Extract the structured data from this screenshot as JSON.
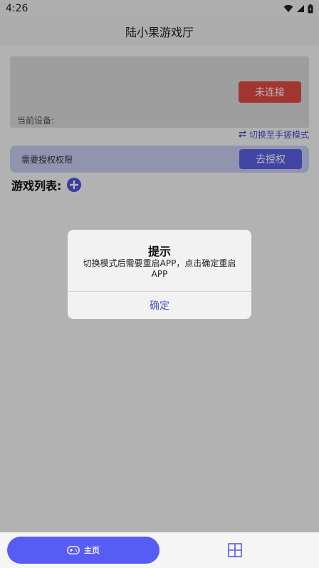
{
  "status_bar": {
    "time": "4:26"
  },
  "app_bar": {
    "title": "陆小果游戏厅"
  },
  "device_card": {
    "device_label": "当前设备:",
    "connect_label": "未连接"
  },
  "switch_mode": {
    "label": "切换至手搓模式"
  },
  "auth_bar": {
    "text": "需要授权权限",
    "button_label": "去授权"
  },
  "game_list": {
    "header": "游戏列表:"
  },
  "bottom_nav": {
    "home_label": "主页"
  },
  "dialog": {
    "title": "提示",
    "message": "切换模式后需要重启APP，点击确定重启APP",
    "confirm_label": "确定"
  },
  "colors": {
    "accent": "#5b60e3",
    "danger": "#e24a44",
    "link": "#4a4ec8"
  }
}
